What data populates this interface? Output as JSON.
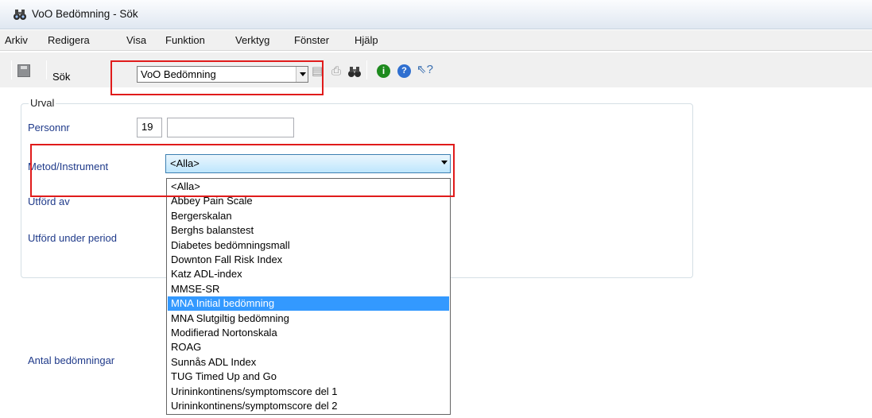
{
  "window": {
    "title": "VoO Bedömning - Sök"
  },
  "menu": [
    "Arkiv",
    "Redigera",
    "Visa",
    "Funktion",
    "Verktyg",
    "Fönster",
    "Hjälp"
  ],
  "toolbar": {
    "search_label": "Sök",
    "select_value": "VoO Bedömning",
    "icons": [
      "save-icon",
      "print-preview-icon",
      "print-icon",
      "binoculars-icon",
      "info-icon",
      "help-icon",
      "context-help-icon"
    ]
  },
  "urval": {
    "legend": "Urval",
    "personnr_label": "Personnr",
    "personnr_prefix": "19",
    "personnr_value": "",
    "metod_label": "Metod/Instrument",
    "metod_value": "<Alla>",
    "utford_av_label": "Utförd av",
    "utford_period_label": "Utförd under period"
  },
  "antal_label": "Antal bedömningar",
  "dropdown": {
    "options": [
      "<Alla>",
      "Abbey Pain Scale",
      "Bergerskalan",
      "Berghs balanstest",
      "Diabetes bedömningsmall",
      "Downton Fall Risk Index",
      "Katz ADL-index",
      "MMSE-SR",
      "MNA Initial bedömning",
      "MNA Slutgiltig bedömning",
      "Modifierad Nortonskala",
      "ROAG",
      "Sunnås ADL Index",
      "TUG Timed Up and Go",
      "Urininkontinens/symptomscore del 1",
      "Urininkontinens/symptomscore del 2"
    ],
    "highlighted": "MNA Initial bedömning"
  },
  "colors": {
    "highlight": "#3399ff",
    "annotation": "#e01b1b",
    "label": "#1f3a8a"
  }
}
